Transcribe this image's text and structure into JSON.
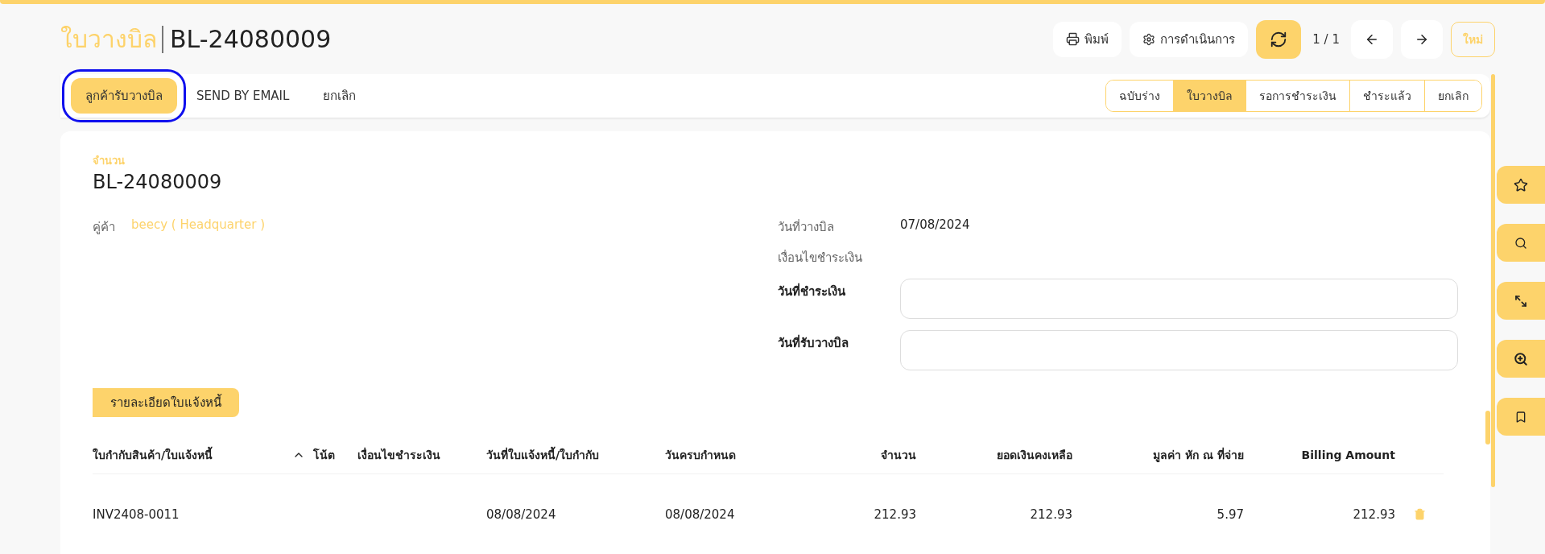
{
  "header": {
    "module": "ใบวางบิล",
    "document": "BL-24080009",
    "print_button": "พิมพ์",
    "action_button": "การดำเนินการ",
    "pager": "1 / 1",
    "new_button": "ใหม่"
  },
  "actions": [
    {
      "label": "ลูกค้ารับวางบิล",
      "primary": true,
      "highlighted": true
    },
    {
      "label": "SEND BY EMAIL",
      "primary": false,
      "highlighted": false
    },
    {
      "label": "ยกเลิก",
      "primary": false,
      "highlighted": false
    }
  ],
  "status_steps": [
    {
      "label": "ฉบับร่าง",
      "selected": false
    },
    {
      "label": "ใบวางบิล",
      "selected": true
    },
    {
      "label": "รอการชำระเงิน",
      "selected": false
    },
    {
      "label": "ชำระแล้ว",
      "selected": false
    },
    {
      "label": "ยกเลิก",
      "selected": false
    }
  ],
  "form": {
    "number_label": "จำนวน",
    "number": "BL-24080009",
    "partner_label": "คู่ค้า",
    "partner": "beecy ( Headquarter )",
    "info": [
      {
        "label": "วันที่วางบิล",
        "value": "07/08/2024"
      },
      {
        "label": "เงื่อนไขชำระเงิน"
      }
    ],
    "inputs": [
      {
        "label": "วันที่ชำระเงิน"
      },
      {
        "label": "วันที่รับวางบิล"
      }
    ]
  },
  "detail_tab": "รายละเอียดใบแจ้งหนี้",
  "table": {
    "columns": [
      {
        "label": "ใบกำกับสินค้า/ใบแจ้งหนี้",
        "sorted": true
      },
      {
        "label": "โน้ต",
        "sorted": false
      },
      {
        "label": "เงื่อนไขชำระเงิน",
        "sorted": false
      },
      {
        "label": "วันที่ใบแจ้งหนี้/ใบกำกับ",
        "sorted": false
      },
      {
        "label": "วันครบกำหนด",
        "sorted": false
      },
      {
        "label": "จำนวน",
        "sorted": false
      },
      {
        "label": "ยอดเงินคงเหลือ",
        "sorted": false
      },
      {
        "label": "มูลค่า หัก ณ ที่จ่าย",
        "sorted": false
      },
      {
        "label": "Billing Amount",
        "sorted": false
      }
    ],
    "rows": [
      {
        "invoice": "INV2408-0011",
        "invoice_date": "08/08/2024",
        "due_date": "08/08/2024",
        "amount": "212.93",
        "balance": "212.93",
        "withholding": "5.97",
        "billing_amount": "212.93"
      }
    ]
  }
}
